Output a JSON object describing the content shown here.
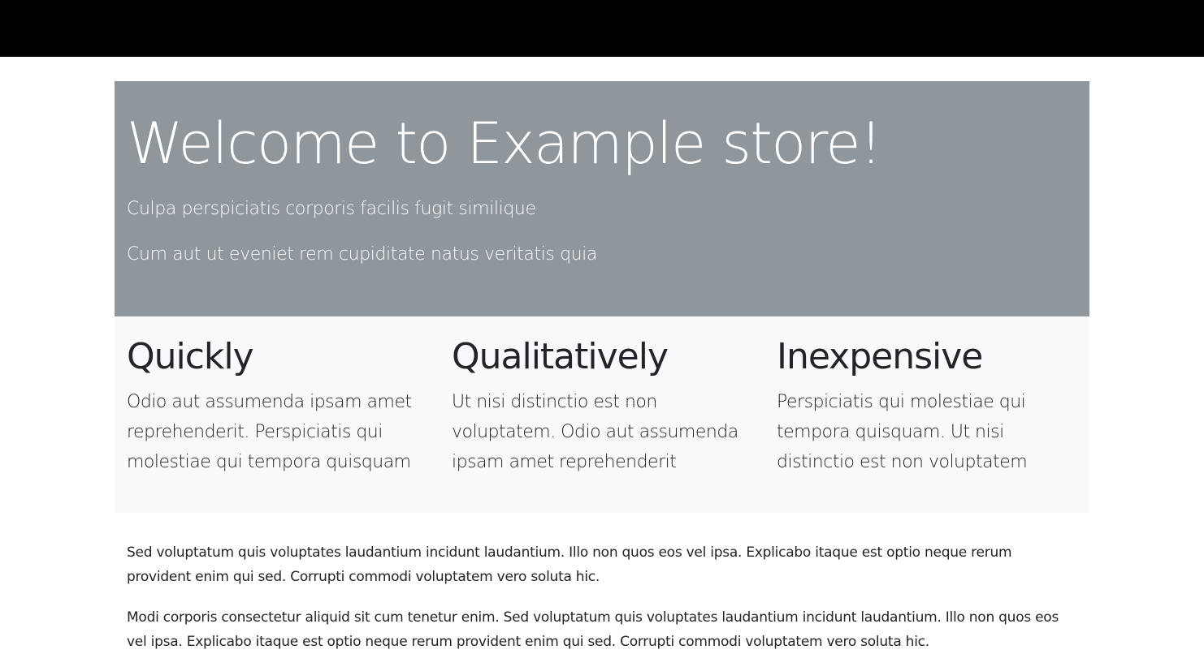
{
  "hero": {
    "title": "Welcome to Example store!",
    "subtitle_1": "Culpa perspiciatis corporis facilis fugit similique",
    "subtitle_2": "Cum aut ut eveniet rem cupiditate natus veritatis quia"
  },
  "features": [
    {
      "title": "Quickly",
      "text": "Odio aut assumenda ipsam amet reprehenderit. Perspiciatis qui molestiae qui tempora quisquam"
    },
    {
      "title": "Qualitatively",
      "text": "Ut nisi distinctio est non voluptatem. Odio aut assumenda ipsam amet reprehenderit"
    },
    {
      "title": "Inexpensive",
      "text": "Perspiciatis qui molestiae qui tempora quisquam. Ut nisi distinctio est non voluptatem"
    }
  ],
  "paragraphs": [
    "Sed voluptatum quis voluptates laudantium incidunt laudantium. Illo non quos eos vel ipsa. Explicabo itaque est optio neque rerum provident enim qui sed. Corrupti commodi voluptatem vero soluta hic.",
    "Modi corporis consectetur aliquid sit cum tenetur enim. Sed voluptatum quis voluptates laudantium incidunt laudantium. Illo non quos eos vel ipsa. Explicabo itaque est optio neque rerum provident enim qui sed. Corrupti commodi voluptatem vero soluta hic."
  ],
  "colors": {
    "topbar": "#000000",
    "hero_background": "#8f969c",
    "features_background": "#f8f9fa",
    "text": "#212529"
  }
}
